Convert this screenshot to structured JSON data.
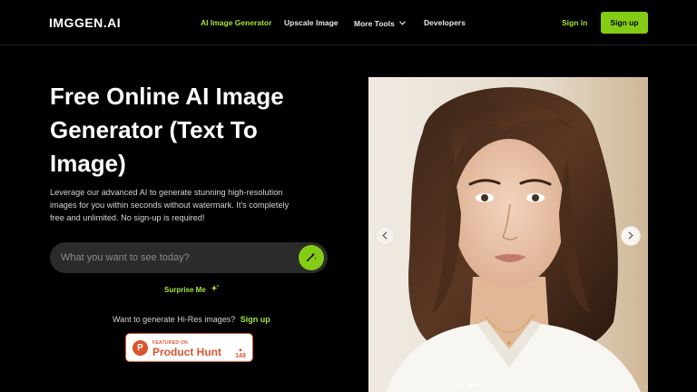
{
  "header": {
    "logo": "IMGGEN.AI",
    "nav": [
      {
        "label": "AI Image Generator",
        "active": true
      },
      {
        "label": "Upscale Image",
        "active": false
      },
      {
        "label": "More Tools",
        "active": false
      },
      {
        "label": "Developers",
        "active": false
      }
    ],
    "signin_label": "Sign in",
    "signup_label": "Sign up"
  },
  "hero": {
    "title": "Free Online AI Image Generator (Text To Image)",
    "description": "Leverage our advanced AI to generate stunning high-resolution images for you within seconds without watermark. It's completely free and unlimited. No sign-up is required!",
    "prompt_placeholder": "What you want to see today?",
    "surprise_label": "Surprise Me",
    "hires_text": "Want to generate Hi-Res images?",
    "hires_link": "Sign up"
  },
  "badge": {
    "featured": "FEATURED ON",
    "name": "Product Hunt",
    "count": "148",
    "logo_letter": "P"
  },
  "slider": {
    "slide_count": 3,
    "active_slide": 1
  },
  "colors": {
    "accent": "#84cc16",
    "accent_text": "#a3e635",
    "background": "#000000",
    "product_hunt": "#da552f"
  }
}
